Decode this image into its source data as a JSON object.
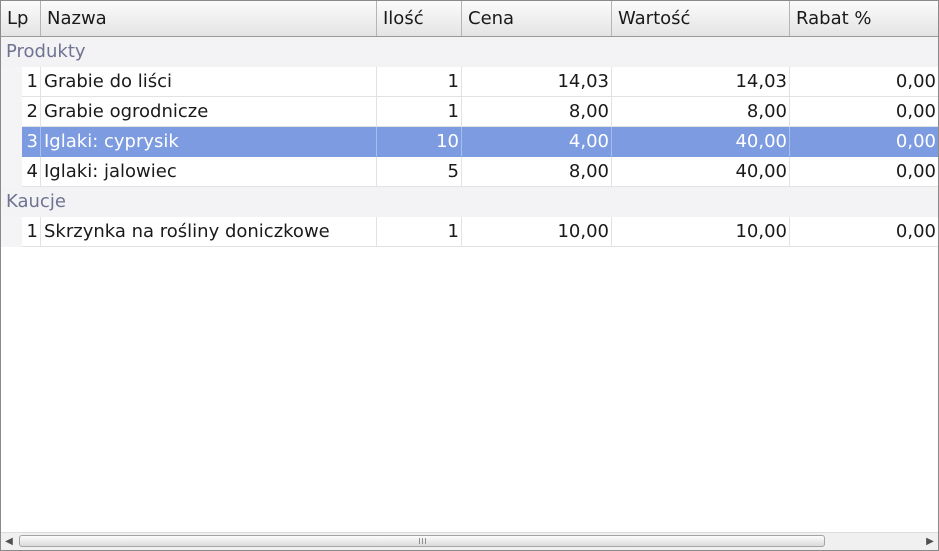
{
  "columns": {
    "lp": "Lp",
    "nazwa": "Nazwa",
    "ilosc": "Ilość",
    "cena": "Cena",
    "wartosc": "Wartość",
    "rabat": "Rabat %"
  },
  "groups": [
    {
      "title": "Produkty",
      "rows": [
        {
          "lp": "1",
          "nazwa": "Grabie do liści",
          "ilosc": "1",
          "cena": "14,03",
          "wartosc": "14,03",
          "rabat": "0,00"
        },
        {
          "lp": "2",
          "nazwa": "Grabie ogrodnicze",
          "ilosc": "1",
          "cena": "8,00",
          "wartosc": "8,00",
          "rabat": "0,00"
        },
        {
          "lp": "3",
          "nazwa": "Iglaki: cyprysik",
          "ilosc": "10",
          "cena": "4,00",
          "wartosc": "40,00",
          "rabat": "0,00"
        },
        {
          "lp": "4",
          "nazwa": "Iglaki: jalowiec",
          "ilosc": "5",
          "cena": "8,00",
          "wartosc": "40,00",
          "rabat": "0,00"
        }
      ]
    },
    {
      "title": "Kaucje",
      "rows": [
        {
          "lp": "1",
          "nazwa": "Skrzynka na rośliny doniczkowe",
          "ilosc": "1",
          "cena": "10,00",
          "wartosc": "10,00",
          "rabat": "0,00"
        }
      ]
    }
  ],
  "selected": {
    "group": 0,
    "row": 2
  },
  "colors": {
    "selection": "#7c9be0",
    "group_text": "#6f7291"
  },
  "scrollbar": {
    "left_arrow_icon": "arrow-left-icon",
    "right_arrow_icon": "arrow-right-icon"
  }
}
